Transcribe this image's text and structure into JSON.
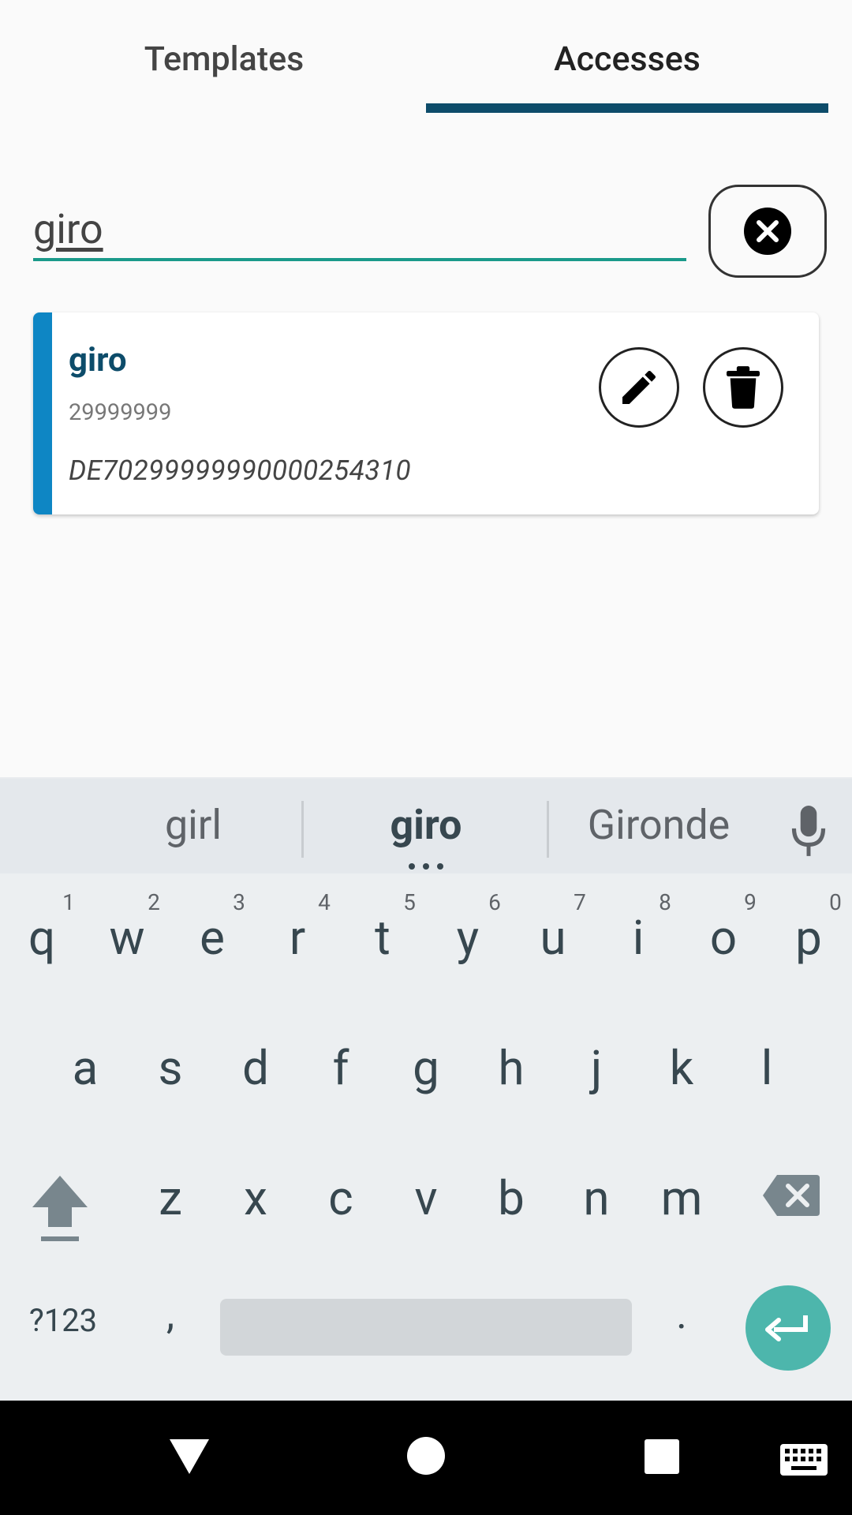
{
  "tabs": [
    {
      "label": "Templates",
      "active": false
    },
    {
      "label": "Accesses",
      "active": true
    }
  ],
  "search": {
    "value": "giro"
  },
  "access_card": {
    "name": "giro",
    "bank_code": "29999999",
    "iban": "DE70299999990000254310"
  },
  "keyboard": {
    "suggestions": [
      "girl",
      "giro",
      "Gironde"
    ],
    "row1": [
      "q",
      "w",
      "e",
      "r",
      "t",
      "y",
      "u",
      "i",
      "o",
      "p"
    ],
    "row1_hints": [
      "1",
      "2",
      "3",
      "4",
      "5",
      "6",
      "7",
      "8",
      "9",
      "0"
    ],
    "row2": [
      "a",
      "s",
      "d",
      "f",
      "g",
      "h",
      "j",
      "k",
      "l"
    ],
    "row3": [
      "z",
      "x",
      "c",
      "v",
      "b",
      "n",
      "m"
    ],
    "symbols_label": "?123",
    "comma": ",",
    "period": "."
  },
  "colors": {
    "tab_indicator": "#0d4c6a",
    "search_underline": "#1a9a8a",
    "card_accent": "#0e86c4",
    "enter_key": "#4db6ac",
    "nav_bar": "#000000"
  }
}
